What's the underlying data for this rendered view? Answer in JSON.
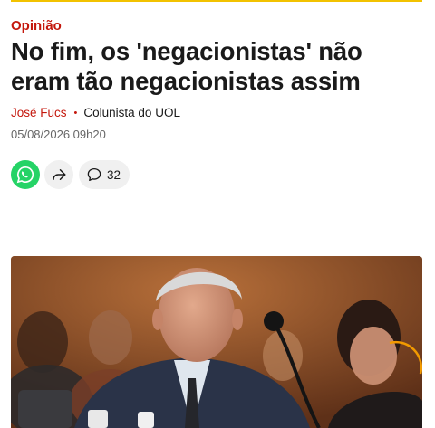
{
  "article": {
    "section": "Opinião",
    "headline": "No fim, os 'negacionistas' não eram tão negacionistas assim",
    "author": "José Fucs",
    "separator": "•",
    "author_role": "Colunista do UOL",
    "published": "05/08/2026 09h20"
  },
  "actions": {
    "whatsapp_icon": "whatsapp-icon",
    "share_icon": "share-arrow-icon",
    "comment_icon": "comment-bubble-icon",
    "comment_count": "32"
  },
  "photo": {
    "subject": "man in suit seated at hearing with microphone"
  },
  "colors": {
    "brand_red": "#c4170c",
    "accent_yellow": "#f2c200",
    "whatsapp_green": "#25d366"
  }
}
